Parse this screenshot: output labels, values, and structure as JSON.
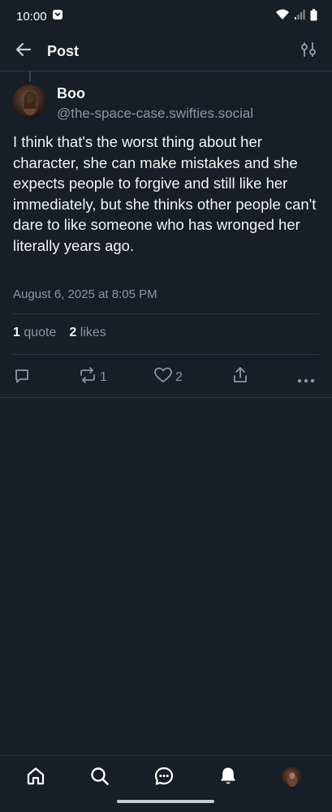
{
  "status_bar": {
    "time": "10:00"
  },
  "header": {
    "title": "Post"
  },
  "post": {
    "author_name": "Boo",
    "author_handle": "@the-space-case.swifties.social",
    "text": "I think that's the worst thing about her character, she can make mistakes and she expects people to forgive and still like her immediately, but she thinks other people can't dare to like someone who has wronged her literally years ago.",
    "timestamp": "August 6, 2025 at 8:05 PM"
  },
  "stats": {
    "quotes_count": "1",
    "quotes_label": "quote",
    "likes_count": "2",
    "likes_label": "likes"
  },
  "actions": {
    "reply_icon": "reply-icon",
    "repost_count": "1",
    "like_count": "2",
    "share_icon": "share-icon",
    "more_icon": "more-icon"
  },
  "bottom_nav": [
    "home-icon",
    "search-icon",
    "chat-icon",
    "notifications-icon",
    "profile-avatar"
  ],
  "colors": {
    "background": "#161e27",
    "text": "#f1f3f5",
    "muted": "#8a96a3",
    "divider": "#2b3642"
  }
}
